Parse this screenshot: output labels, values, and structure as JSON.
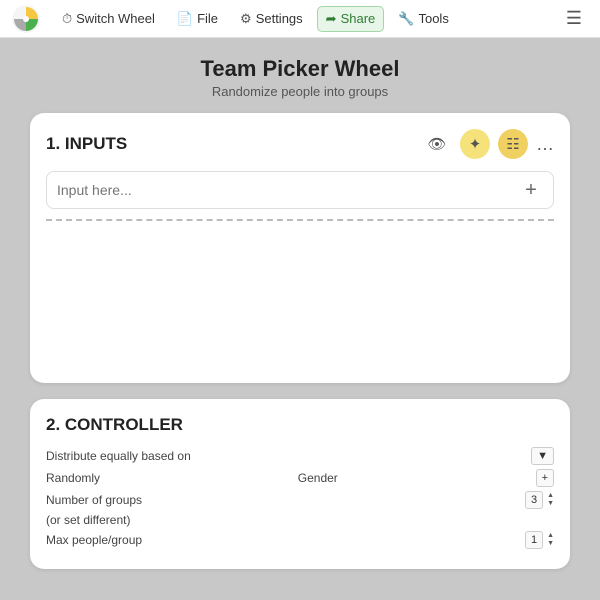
{
  "nav": {
    "switch_wheel_label": "Switch Wheel",
    "file_label": "File",
    "settings_label": "Settings",
    "share_label": "Share",
    "tools_label": "Tools"
  },
  "page": {
    "title": "Team Picker Wheel",
    "subtitle": "Randomize people into groups"
  },
  "inputs_section": {
    "title": "1. INPUTS",
    "input_placeholder": "Input here...",
    "add_button_label": "+"
  },
  "controller_section": {
    "title": "2. CONTROLLER",
    "distribute_label": "Distribute equally based on",
    "random_label": "Randomly",
    "gender_label": "Gender",
    "number_of_groups_label": "Number of groups",
    "set_different_label": "(or set different)",
    "max_people_label": "Max people/group",
    "number_of_groups_value": "3",
    "max_people_value": "1"
  }
}
